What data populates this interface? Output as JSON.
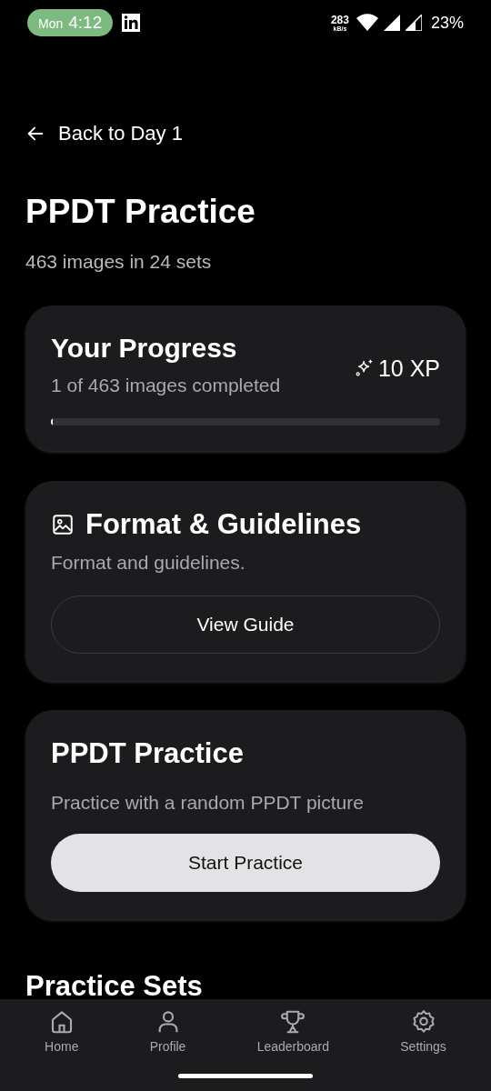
{
  "status_bar": {
    "day": "Mon",
    "time": "4:12",
    "speed": "283",
    "speed_unit": "kB/s",
    "battery": "23%"
  },
  "back_link": "Back to Day 1",
  "title": "PPDT Practice",
  "subtitle": "463 images in 24 sets",
  "progress_card": {
    "title": "Your Progress",
    "caption": "1 of 463 images completed",
    "xp": "10 XP",
    "level": 0.003
  },
  "guidelines_card": {
    "title": "Format & Guidelines",
    "text": "Format and guidelines.",
    "button": "View Guide"
  },
  "practice_card": {
    "title": "PPDT Practice",
    "text": "Practice with a random PPDT picture",
    "button": "Start Practice"
  },
  "section_heading": "Practice Sets",
  "nav": [
    {
      "label": "Home",
      "selected": false
    },
    {
      "label": "Profile",
      "selected": false
    },
    {
      "label": "Leaderboard",
      "selected": false
    },
    {
      "label": "Settings",
      "selected": false
    }
  ]
}
